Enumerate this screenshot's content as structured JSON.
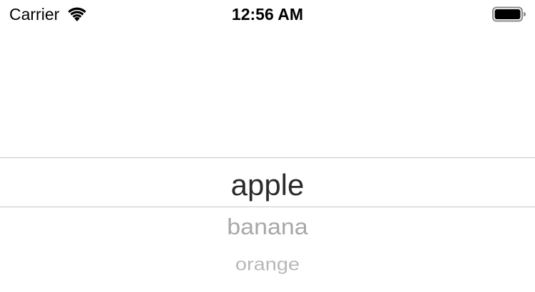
{
  "status_bar": {
    "carrier": "Carrier",
    "time": "12:56 AM",
    "wifi_icon": "wifi-icon",
    "battery_icon": "battery-icon"
  },
  "picker": {
    "selected": "apple",
    "items": [
      "apple",
      "banana",
      "orange"
    ]
  }
}
